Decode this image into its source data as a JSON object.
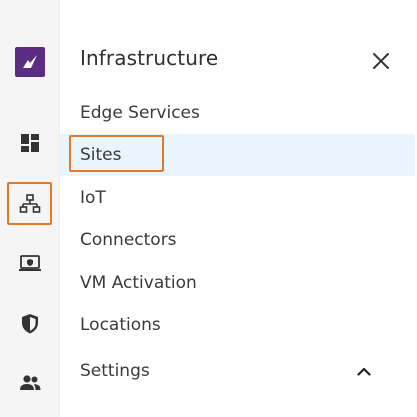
{
  "rail": {
    "items": [
      {
        "icon": "brand-logo-icon"
      },
      {
        "icon": "dashboard-icon"
      },
      {
        "icon": "network-hierarchy-icon",
        "active": true
      },
      {
        "icon": "laptop-shield-icon"
      },
      {
        "icon": "shield-icon"
      },
      {
        "icon": "users-icon"
      }
    ]
  },
  "panel": {
    "title": "Infrastructure",
    "close_icon": "close-icon",
    "items": [
      {
        "label": "Edge Services"
      },
      {
        "label": "Sites",
        "active": true
      },
      {
        "label": "IoT"
      },
      {
        "label": "Connectors"
      },
      {
        "label": "VM Activation"
      },
      {
        "label": "Locations"
      },
      {
        "label": "Settings",
        "expand_icon": "chevron-up-icon"
      }
    ]
  },
  "colors": {
    "rail_bg": "#f5f5f5",
    "brand": "#5b2d82",
    "highlight_outline": "#e57a26",
    "active_item_bg": "#e9f4fc",
    "text": "#3a3a3e",
    "icon": "#333333"
  }
}
